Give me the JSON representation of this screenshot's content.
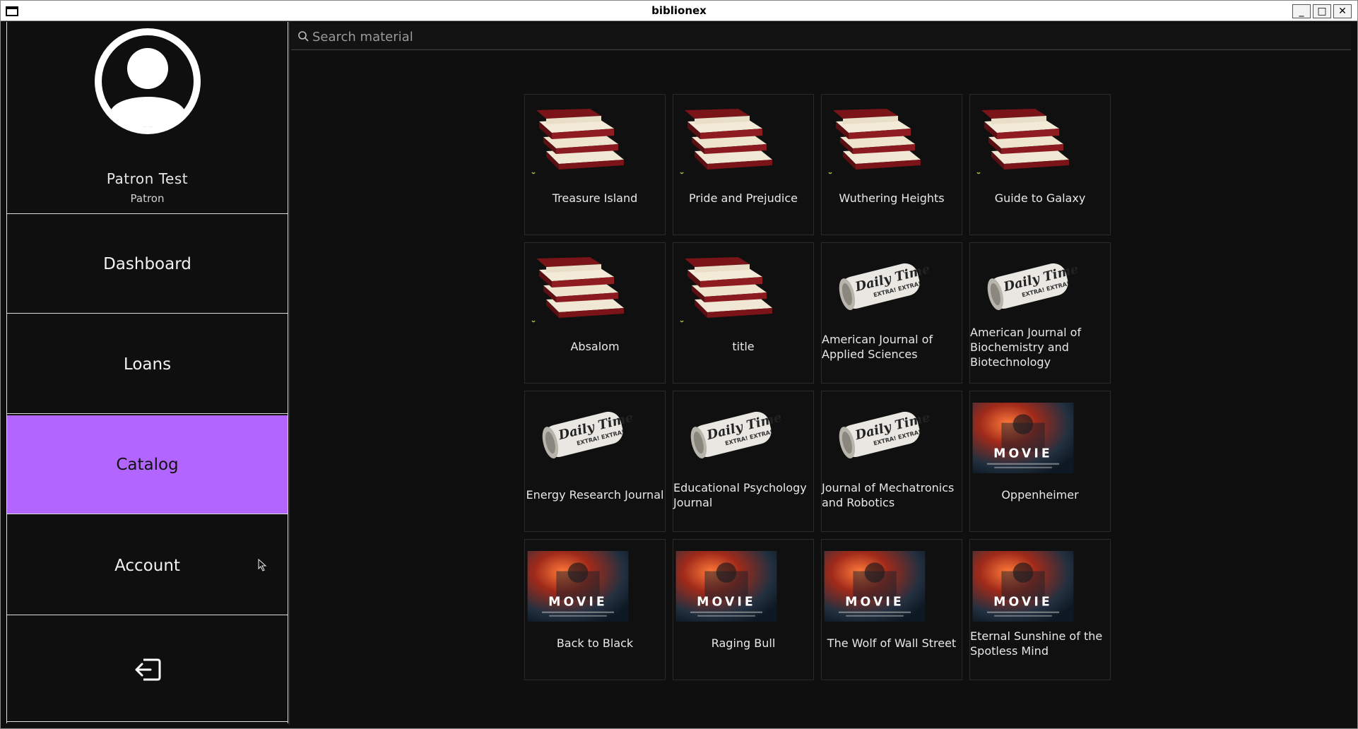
{
  "window": {
    "title": "biblionex",
    "minimize": "_",
    "maximize": "□",
    "close": "✕"
  },
  "profile": {
    "name": "Patron Test",
    "role": "Patron"
  },
  "nav": {
    "dashboard": "Dashboard",
    "loans": "Loans",
    "catalog": "Catalog",
    "account": "Account"
  },
  "search": {
    "placeholder": "Search material",
    "value": ""
  },
  "colors": {
    "accent": "#b266ff",
    "background": "#0f0f0f"
  },
  "catalog": [
    {
      "title": "Treasure Island",
      "type": "book"
    },
    {
      "title": "Pride and Prejudice",
      "type": "book"
    },
    {
      "title": "Wuthering Heights",
      "type": "book"
    },
    {
      "title": "Guide to Galaxy",
      "type": "book"
    },
    {
      "title": "Absalom",
      "type": "book"
    },
    {
      "title": "title",
      "type": "book"
    },
    {
      "title": "American Journal of Applied Sciences",
      "type": "journal"
    },
    {
      "title": "American Journal of Biochemistry and Biotechnology",
      "type": "journal"
    },
    {
      "title": "Energy Research Journal",
      "type": "journal"
    },
    {
      "title": "Educational Psychology Journal",
      "type": "journal"
    },
    {
      "title": "Journal of Mechatronics and Robotics",
      "type": "journal"
    },
    {
      "title": "Oppenheimer",
      "type": "movie"
    },
    {
      "title": "Back to Black",
      "type": "movie"
    },
    {
      "title": "Raging Bull",
      "type": "movie"
    },
    {
      "title": "The Wolf of Wall Street",
      "type": "movie"
    },
    {
      "title": "Eternal Sunshine of the Spotless Mind",
      "type": "movie"
    }
  ],
  "icons": {
    "search": "search-icon",
    "avatar": "user-avatar-icon",
    "logout": "logout-icon"
  }
}
